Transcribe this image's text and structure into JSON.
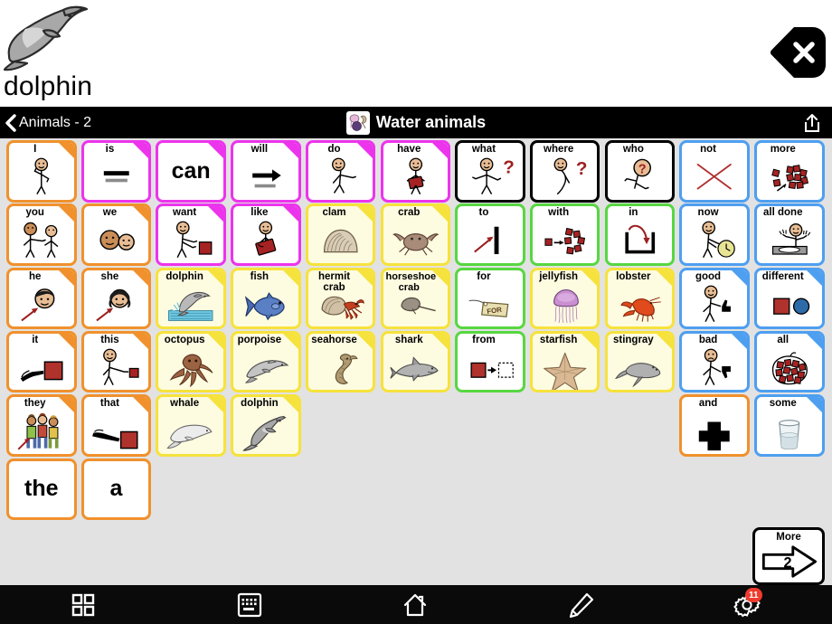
{
  "message_bar": {
    "word": "dolphin",
    "symbol": "dolphin-symbol",
    "close_icon": "close-icon"
  },
  "navbar": {
    "back_label": "Animals - 2",
    "back_icon": "chevron-left-icon",
    "title": "Water animals",
    "title_icon": "water-animals-icon",
    "share_icon": "share-icon"
  },
  "more_button": {
    "label": "More",
    "count": "2",
    "icon": "arrow-right-icon"
  },
  "toolbar": {
    "items": [
      {
        "name": "grid-icon",
        "badge": ""
      },
      {
        "name": "keyboard-icon",
        "badge": ""
      },
      {
        "name": "home-icon",
        "badge": ""
      },
      {
        "name": "pencil-icon",
        "badge": ""
      },
      {
        "name": "gear-icon",
        "badge": "11"
      }
    ]
  },
  "colors": {
    "pronoun": "#f0912d",
    "verb": "#ec34ec",
    "noun": "#f6e23c",
    "preposition": "#57d741",
    "descriptor": "#4e9ff0",
    "question": "#000000",
    "noun_fill": "#fdfbe0"
  },
  "grid": {
    "columns": 8,
    "rows": 6,
    "buttons": [
      {
        "row": 0,
        "col": 0,
        "label": "I",
        "color": "orange",
        "art": "person-pointing-self",
        "fold": true
      },
      {
        "row": 0,
        "col": 1,
        "label": "is",
        "color": "magenta",
        "art": "equals-bars",
        "fold": true
      },
      {
        "row": 0,
        "col": 2,
        "label": "can",
        "color": "magenta",
        "art": "text-only",
        "fold": true,
        "text": "can"
      },
      {
        "row": 0,
        "col": 3,
        "label": "will",
        "color": "magenta",
        "art": "arrow-right-bar",
        "fold": true
      },
      {
        "row": 0,
        "col": 4,
        "label": "do",
        "color": "magenta",
        "art": "person-doing",
        "fold": true
      },
      {
        "row": 0,
        "col": 5,
        "label": "have",
        "color": "magenta",
        "art": "person-holding",
        "fold": true
      },
      {
        "row": 0,
        "col": 6,
        "label": "what",
        "color": "black",
        "art": "person-question",
        "fold": false
      },
      {
        "row": 0,
        "col": 7,
        "label": "where",
        "color": "black",
        "art": "person-looking-question",
        "fold": false
      },
      {
        "row": 0,
        "col": 8,
        "label": "who",
        "color": "black",
        "art": "face-question",
        "fold": false
      },
      {
        "row": 0,
        "col": 9,
        "label": "not",
        "color": "blue",
        "art": "red-x",
        "fold": false
      },
      {
        "row": 0,
        "col": 10,
        "label": "more",
        "color": "blue",
        "art": "more-blocks",
        "fold": false
      },
      {
        "row": 1,
        "col": 0,
        "label": "you",
        "color": "orange",
        "art": "two-people-pointing",
        "fold": true
      },
      {
        "row": 1,
        "col": 1,
        "label": "we",
        "color": "orange",
        "art": "two-faces",
        "fold": true
      },
      {
        "row": 1,
        "col": 2,
        "label": "want",
        "color": "magenta",
        "art": "person-reaching-block",
        "fold": true
      },
      {
        "row": 1,
        "col": 3,
        "label": "like",
        "color": "magenta",
        "art": "person-hugging-heart",
        "fold": true
      },
      {
        "row": 1,
        "col": 4,
        "label": "clam",
        "color": "yellow",
        "art": "clam",
        "fold": true
      },
      {
        "row": 1,
        "col": 5,
        "label": "crab",
        "color": "yellow",
        "art": "crab",
        "fold": true
      },
      {
        "row": 1,
        "col": 6,
        "label": "to",
        "color": "green",
        "art": "arrow-to-bar",
        "fold": false
      },
      {
        "row": 1,
        "col": 7,
        "label": "with",
        "color": "green",
        "art": "blocks-with",
        "fold": false
      },
      {
        "row": 1,
        "col": 8,
        "label": "in",
        "color": "green",
        "art": "arrow-into-box",
        "fold": false
      },
      {
        "row": 1,
        "col": 9,
        "label": "now",
        "color": "blue",
        "art": "person-clock",
        "fold": false
      },
      {
        "row": 1,
        "col": 10,
        "label": "all done",
        "color": "blue",
        "art": "person-empty-plate",
        "fold": false
      },
      {
        "row": 2,
        "col": 0,
        "label": "he",
        "color": "orange",
        "art": "boy-face-arrow",
        "fold": true
      },
      {
        "row": 2,
        "col": 1,
        "label": "she",
        "color": "orange",
        "art": "girl-face-arrow",
        "fold": true
      },
      {
        "row": 2,
        "col": 2,
        "label": "dolphin",
        "color": "yellow",
        "art": "dolphin-jumping",
        "fold": true
      },
      {
        "row": 2,
        "col": 3,
        "label": "fish",
        "color": "yellow",
        "art": "fish",
        "fold": true
      },
      {
        "row": 2,
        "col": 4,
        "label": "hermit crab",
        "color": "yellow",
        "art": "hermit-crab",
        "fold": true
      },
      {
        "row": 2,
        "col": 5,
        "label": "horseshoe crab",
        "color": "yellow",
        "art": "horseshoe-crab",
        "fold": true
      },
      {
        "row": 2,
        "col": 6,
        "label": "for",
        "color": "green",
        "art": "for-tag",
        "fold": false
      },
      {
        "row": 2,
        "col": 7,
        "label": "jellyfish",
        "color": "yellow",
        "art": "jellyfish",
        "fold": true
      },
      {
        "row": 2,
        "col": 8,
        "label": "lobster",
        "color": "yellow",
        "art": "lobster",
        "fold": true
      },
      {
        "row": 2,
        "col": 9,
        "label": "good",
        "color": "blue",
        "art": "person-thumbs-up",
        "fold": true
      },
      {
        "row": 2,
        "col": 10,
        "label": "different",
        "color": "blue",
        "art": "square-circle",
        "fold": true
      },
      {
        "row": 3,
        "col": 0,
        "label": "it",
        "color": "orange",
        "art": "hand-pointing-block",
        "fold": true
      },
      {
        "row": 3,
        "col": 1,
        "label": "this",
        "color": "orange",
        "art": "person-pointing-block",
        "fold": true
      },
      {
        "row": 3,
        "col": 2,
        "label": "octopus",
        "color": "yellow",
        "art": "octopus",
        "fold": true
      },
      {
        "row": 3,
        "col": 3,
        "label": "porpoise",
        "color": "yellow",
        "art": "porpoise",
        "fold": true
      },
      {
        "row": 3,
        "col": 4,
        "label": "seahorse",
        "color": "yellow",
        "art": "seahorse",
        "fold": true
      },
      {
        "row": 3,
        "col": 5,
        "label": "shark",
        "color": "yellow",
        "art": "shark",
        "fold": true
      },
      {
        "row": 3,
        "col": 6,
        "label": "from",
        "color": "green",
        "art": "block-arrow-outline",
        "fold": false
      },
      {
        "row": 3,
        "col": 7,
        "label": "starfish",
        "color": "yellow",
        "art": "starfish",
        "fold": true
      },
      {
        "row": 3,
        "col": 8,
        "label": "stingray",
        "color": "yellow",
        "art": "stingray",
        "fold": true
      },
      {
        "row": 3,
        "col": 9,
        "label": "bad",
        "color": "blue",
        "art": "person-thumbs-down",
        "fold": true
      },
      {
        "row": 3,
        "col": 10,
        "label": "all",
        "color": "blue",
        "art": "circled-blocks",
        "fold": true
      },
      {
        "row": 4,
        "col": 0,
        "label": "they",
        "color": "orange",
        "art": "three-people",
        "fold": true
      },
      {
        "row": 4,
        "col": 1,
        "label": "that",
        "color": "orange",
        "art": "hand-pointing-far",
        "fold": true
      },
      {
        "row": 4,
        "col": 2,
        "label": "whale",
        "color": "yellow",
        "art": "whale",
        "fold": true
      },
      {
        "row": 4,
        "col": 3,
        "label": "dolphin",
        "color": "yellow",
        "art": "dolphin",
        "fold": true
      },
      {
        "row": 4,
        "col": 9,
        "label": "and",
        "color": "orange",
        "art": "plus-sign",
        "fold": false
      },
      {
        "row": 4,
        "col": 10,
        "label": "some",
        "color": "blue",
        "art": "glass-half",
        "fold": true
      },
      {
        "row": 5,
        "col": 0,
        "label": "the",
        "color": "orange",
        "art": "text-only",
        "fold": false,
        "text": "the"
      },
      {
        "row": 5,
        "col": 1,
        "label": "a",
        "color": "orange",
        "art": "text-only",
        "fold": false,
        "text": "a"
      }
    ]
  }
}
